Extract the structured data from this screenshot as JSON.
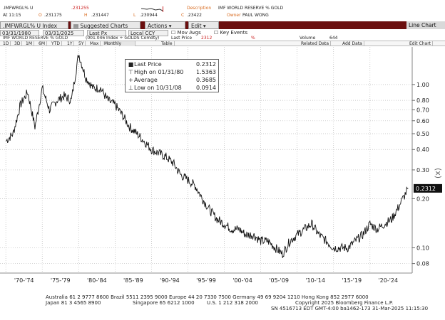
{
  "header": {
    "ticker": ".IMFWRGL% U",
    "last_price_red": ".231255",
    "description_label": "Description",
    "description_value": "IMF WORLD RESERVE % GOLD",
    "time": "At 11:15",
    "open_label": "O",
    "open_value": ".231175",
    "high_label": "H",
    "high_value": ".231447",
    "low_label": "L",
    "low_value": ".230944",
    "close_label": "C",
    "close_value": ".23422",
    "owner_label": "Owner",
    "owner_value": "PAUL WONG"
  },
  "toolbar": {
    "index_label": ".IMFWRGL% U Index",
    "suggested": "Suggested Charts",
    "actions": "Actions",
    "edit": "Edit",
    "line_chart": "Line Chart"
  },
  "range": {
    "start": "03/31/1980",
    "end": "03/31/2025",
    "last_px": "Last Px",
    "currency": "Local CCY",
    "mov_avgs": "Mov Avgs",
    "key_events": "Key Events"
  },
  "periods": {
    "items": [
      "1D",
      "3D",
      "1M",
      "6M",
      "YTD",
      "1Y",
      "5Y",
      "Max"
    ],
    "frequency": "Monthly",
    "table": "Table",
    "related": "Related Data",
    "add_data": "Add Data",
    "edit_chart": "Edit Chart"
  },
  "series_bar": {
    "title": "IMF WORLD RESERVE % GOLD",
    "formula": "(001.046 Index ÷ GOLDS Comdty)",
    "last_label": "Last Price",
    "last_value": "2312",
    "pct": "%",
    "volume_label": "Volume",
    "volume_value": "644"
  },
  "legend": {
    "rows": [
      {
        "sym": "■",
        "label": "Last Price",
        "value": "0.2312"
      },
      {
        "sym": "⊤",
        "label": "High on 01/31/80",
        "value": "1.5363"
      },
      {
        "sym": "+",
        "label": "Average",
        "value": "0.3685"
      },
      {
        "sym": "⊥",
        "label": "Low on 10/31/08",
        "value": "0.0914"
      }
    ]
  },
  "chart_data": {
    "type": "line",
    "title": "IMF WORLD RESERVE % GOLD",
    "y_scale": "log",
    "ylim": [
      0.07,
      1.7
    ],
    "y_ticks": [
      "1.00",
      "0.80",
      "0.70",
      "0.60",
      "0.50",
      "0.40",
      "0.30",
      "0.20",
      "0.10",
      "0.08"
    ],
    "y_axis_unit": "(x)",
    "last_value_label": "0.2312",
    "x_ticks": [
      "'70-'74",
      "'75-'79",
      "'80-'84",
      "'85-'89",
      "'90-'94",
      "'95-'99",
      "'00-'04",
      "'05-'09",
      "'10-'14",
      "'15-'19",
      "'20-'24"
    ],
    "series": [
      {
        "name": "Last Price",
        "x": [
          1970,
          1971,
          1972,
          1973,
          1974,
          1975,
          1976,
          1977,
          1978,
          1979,
          1980,
          1981,
          1982,
          1983,
          1984,
          1985,
          1986,
          1987,
          1988,
          1989,
          1990,
          1991,
          1992,
          1993,
          1994,
          1995,
          1996,
          1997,
          1998,
          1999,
          2000,
          2001,
          2002,
          2003,
          2004,
          2005,
          2006,
          2007,
          2008,
          2009,
          2010,
          2011,
          2012,
          2013,
          2014,
          2015,
          2016,
          2017,
          2018,
          2019,
          2020,
          2021,
          2022,
          2023,
          2024,
          2025.25
        ],
        "y": [
          0.45,
          0.5,
          0.75,
          0.9,
          0.55,
          0.95,
          0.7,
          0.8,
          0.85,
          0.8,
          1.5363,
          1.1,
          0.95,
          0.95,
          0.8,
          0.75,
          0.65,
          0.55,
          0.5,
          0.45,
          0.4,
          0.38,
          0.36,
          0.33,
          0.28,
          0.26,
          0.24,
          0.2,
          0.17,
          0.15,
          0.14,
          0.13,
          0.13,
          0.12,
          0.12,
          0.11,
          0.11,
          0.1,
          0.0914,
          0.11,
          0.12,
          0.13,
          0.14,
          0.12,
          0.11,
          0.1,
          0.1,
          0.1,
          0.11,
          0.12,
          0.14,
          0.13,
          0.14,
          0.15,
          0.18,
          0.2312
        ]
      }
    ]
  },
  "footer": {
    "line1": "Australia 61 2 9777 8600 Brazil 5511 2395 9000 Europe 44 20 7330 7500 Germany 49 69 9204 1210 Hong Kong 852 2977 6000",
    "line2_left": "Japan 81 3 4565 8900",
    "line2_mid": "Singapore 65 6212 1000",
    "line2_mid2": "U.S. 1 212 318 2000",
    "line2_right": "Copyright 2025 Bloomberg Finance L.P.",
    "line3": "SN 4516713 EDT  GMT-4:00 ba1462-173 31-Mar-2025 11:15:30"
  },
  "colors": {
    "toolbar_bg": "#6b0f0f",
    "accent_orange": "#d86a1f",
    "price_red": "#cc2222",
    "line": "#111111"
  }
}
